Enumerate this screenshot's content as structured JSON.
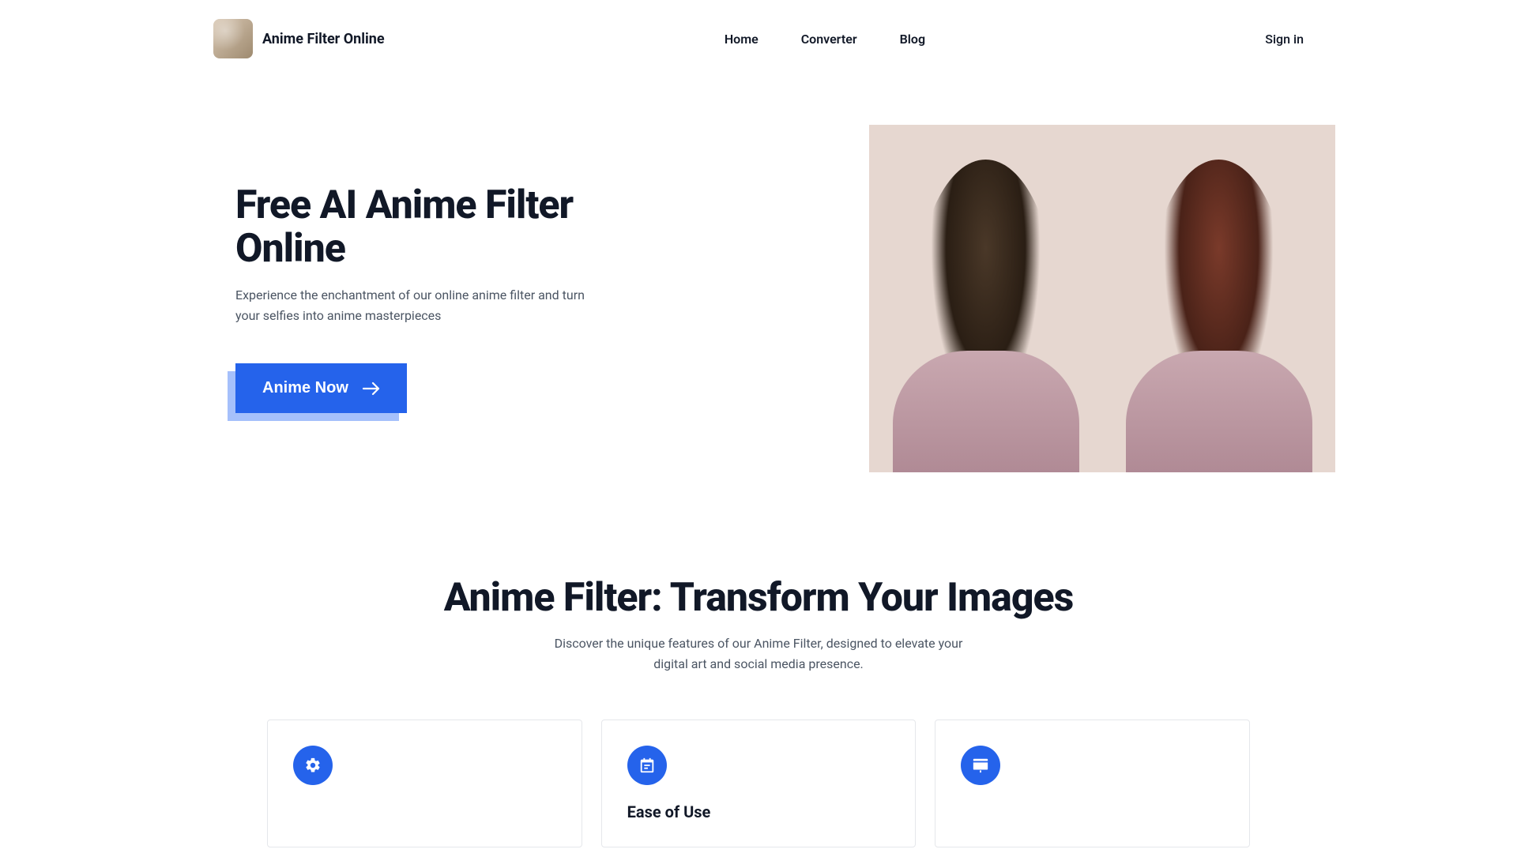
{
  "header": {
    "brand": "Anime Filter Online",
    "nav": {
      "home": "Home",
      "converter": "Converter",
      "blog": "Blog"
    },
    "signin": "Sign in"
  },
  "hero": {
    "title": "Free AI Anime Filter Online",
    "subtitle": "Experience the enchantment of our online anime filter and turn your selfies into anime masterpieces",
    "cta_label": "Anime Now"
  },
  "features": {
    "title": "Anime Filter: Transform Your Images",
    "subtitle": "Discover the unique features of our Anime Filter, designed to elevate your digital art and social media presence.",
    "cards": [
      {
        "title": ""
      },
      {
        "title": "Ease of Use"
      },
      {
        "title": ""
      }
    ]
  }
}
